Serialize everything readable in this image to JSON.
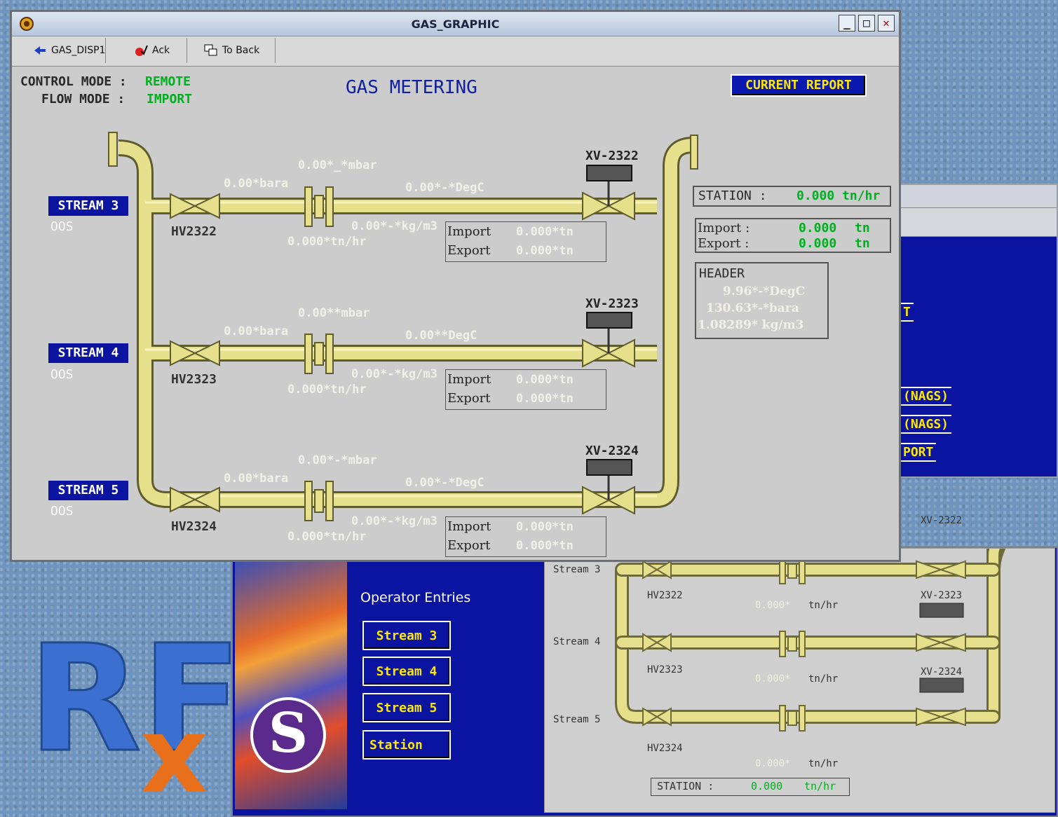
{
  "main_window": {
    "title": "GAS_GRAPHIC",
    "toolbar": {
      "btn1": "GAS_DISP1",
      "btn2": "Ack",
      "btn3": "To Back"
    }
  },
  "mode": {
    "control_label": "CONTROL MODE  :",
    "control_value": "REMOTE",
    "flow_label": "FLOW MODE  :",
    "flow_value": "IMPORT"
  },
  "page_title": "GAS METERING",
  "current_report": "CURRENT REPORT",
  "streams": [
    {
      "label": "STREAM 3",
      "oos": "OOS",
      "hv": "HV2322",
      "xv": "XV-2322",
      "mbar": "0.00*_*mbar",
      "bara": "0.00*bara",
      "degc": "0.00*-*DegC",
      "kgm3": "0.00*-*kg/m3",
      "flow": "0.000*tn/hr",
      "import_label": "Import",
      "import_value": "0.000*tn",
      "export_label": "Export",
      "export_value": "0.000*tn"
    },
    {
      "label": "STREAM 4",
      "oos": "OOS",
      "hv": "HV2323",
      "xv": "XV-2323",
      "mbar": "0.00**mbar",
      "bara": "0.00*bara",
      "degc": "0.00**DegC",
      "kgm3": "0.00*-*kg/m3",
      "flow": "0.000*tn/hr",
      "import_label": "Import",
      "import_value": "0.000*tn",
      "export_label": "Export",
      "export_value": "0.000*tn"
    },
    {
      "label": "STREAM 5",
      "oos": "OOS",
      "hv": "HV2324",
      "xv": "XV-2324",
      "mbar": "0.00*-*mbar",
      "bara": "0.00*bara",
      "degc": "0.00*-*DegC",
      "kgm3": "0.00*-*kg/m3",
      "flow": "0.000*tn/hr",
      "import_label": "Import",
      "import_value": "0.000*tn",
      "export_label": "Export",
      "export_value": "0.000*tn"
    }
  ],
  "station": {
    "label": "STATION  :",
    "value": "0.000 tn/hr"
  },
  "totals": {
    "import_label": "Import  :",
    "import_value": "0.000",
    "import_unit": "tn",
    "export_label": "Export  :",
    "export_value": "0.000",
    "export_unit": "tn"
  },
  "header": {
    "title": "HEADER",
    "temp": "9.96*-*DegC",
    "press": "130.63*-*bara",
    "density": "1.08289* kg/m3"
  },
  "back_right_window": {
    "items": [
      "T",
      "(NAGS)",
      "(NAGS)",
      "PORT"
    ]
  },
  "back_main_window": {
    "operator_entries": "Operator Entries",
    "buttons": [
      "Stream 3",
      "Stream 4",
      "Stream 5",
      "Station"
    ],
    "schematic": {
      "stream_labels": [
        "Stream 3",
        "Stream 4",
        "Stream 5"
      ],
      "hv_labels": [
        "HV2322",
        "HV2323",
        "HV2324"
      ],
      "xv_labels": [
        "XV-2322",
        "XV-2323",
        "XV-2324"
      ],
      "flow_value": "0.000*",
      "flow_unit": "tn/hr",
      "station_label": "STATION :",
      "station_value": "0.000",
      "station_unit": "tn/hr"
    }
  },
  "desktop_logo_text": "RFx",
  "colors": {
    "pipe": "#e6e08c",
    "pipe_edge": "#7a7640",
    "panel_bg": "#cccccc",
    "nav_blue": "#0a14a0",
    "value_green": "#00b020",
    "button_yellow": "#ffe800"
  }
}
